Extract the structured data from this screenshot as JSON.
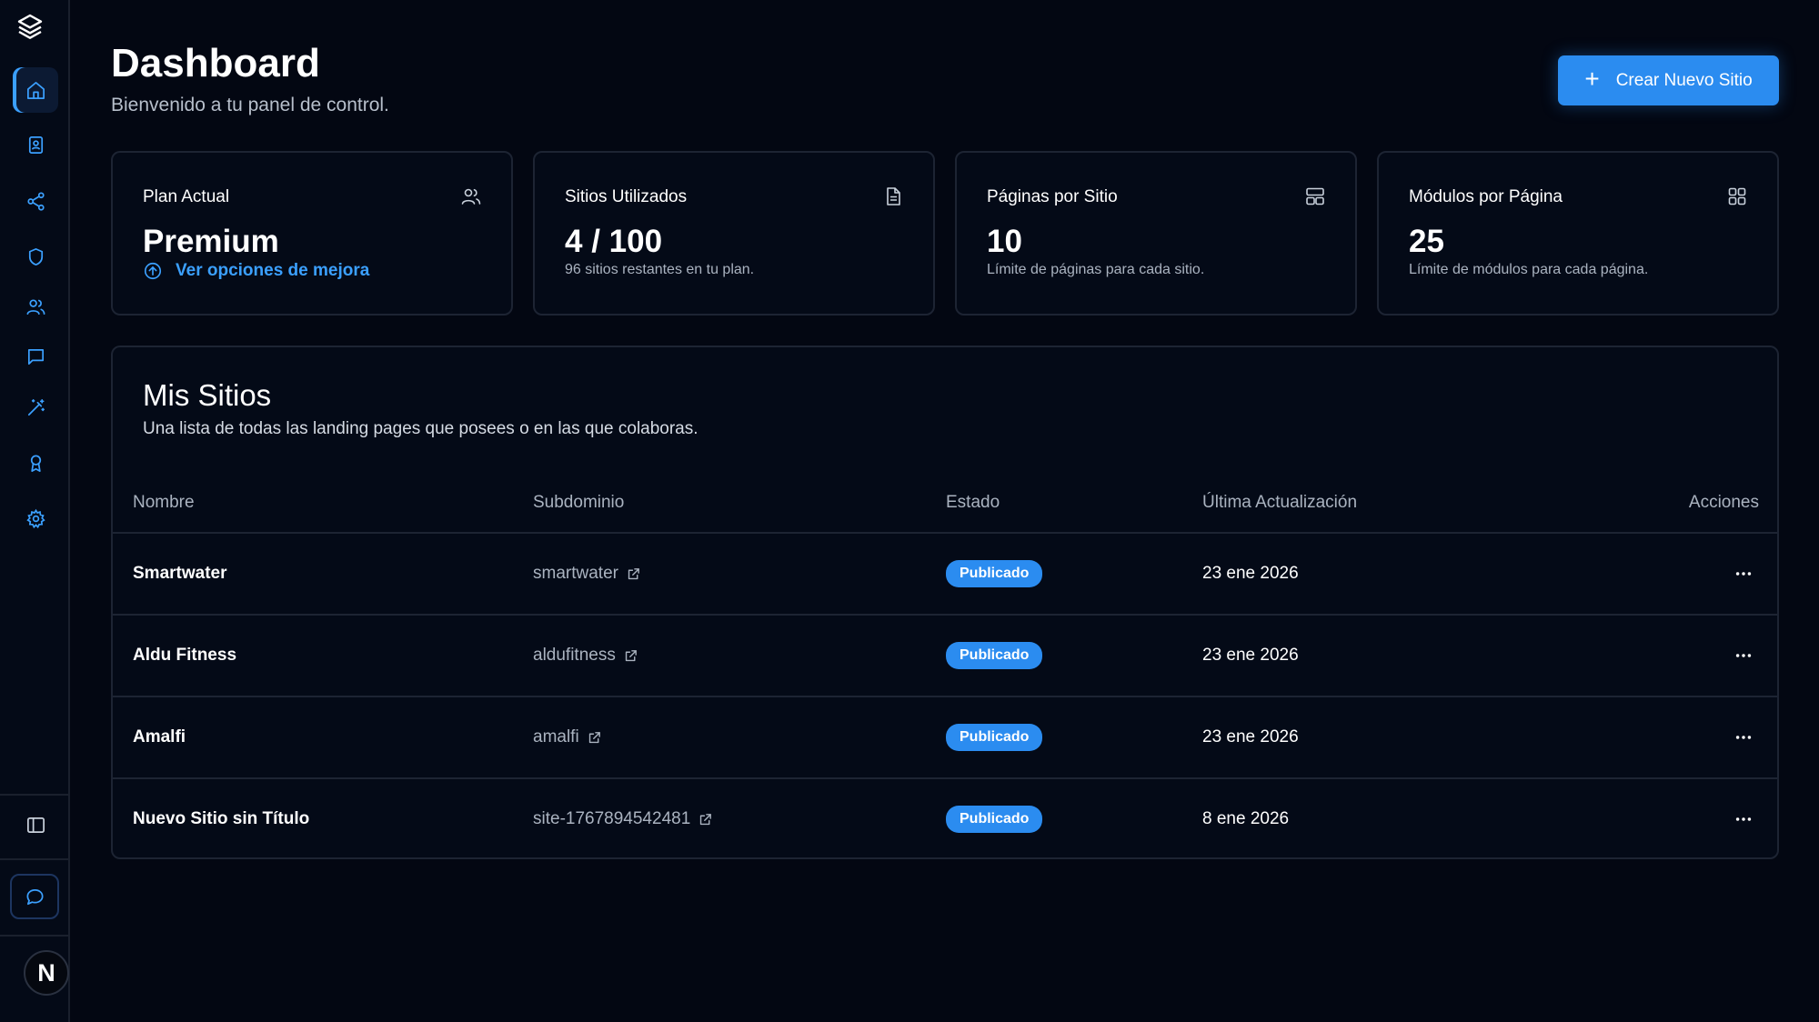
{
  "header": {
    "title": "Dashboard",
    "subtitle": "Bienvenido a tu panel de control.",
    "create_button_label": "Crear Nuevo Sitio"
  },
  "stats": [
    {
      "title": "Plan Actual",
      "value": "Premium",
      "link": "Ver opciones de mejora",
      "icon": "users-icon"
    },
    {
      "title": "Sitios Utilizados",
      "value": "4 / 100",
      "note": "96 sitios restantes en tu plan.",
      "icon": "document-icon"
    },
    {
      "title": "Páginas por Sitio",
      "value": "10",
      "note": "Límite de páginas para cada sitio.",
      "icon": "layout-icon"
    },
    {
      "title": "Módulos por Página",
      "value": "25",
      "note": "Límite de módulos para cada página.",
      "icon": "grid-icon"
    }
  ],
  "sites": {
    "title": "Mis Sitios",
    "description": "Una lista de todas las landing pages que posees o en las que colaboras.",
    "columns": [
      "Nombre",
      "Subdominio",
      "Estado",
      "Última Actualización",
      "Acciones"
    ],
    "rows": [
      {
        "name": "Smartwater",
        "subdomain": "smartwater",
        "status": "Publicado",
        "updated": "23 ene 2026"
      },
      {
        "name": "Aldu Fitness",
        "subdomain": "aldufitness",
        "status": "Publicado",
        "updated": "23 ene 2026"
      },
      {
        "name": "Amalfi",
        "subdomain": "amalfi",
        "status": "Publicado",
        "updated": "23 ene 2026"
      },
      {
        "name": "Nuevo Sitio sin Título",
        "subdomain": "site-1767894542481",
        "status": "Publicado",
        "updated": "8 ene 2026"
      }
    ]
  },
  "user": {
    "avatar_initial": "N"
  },
  "colors": {
    "background": "#030712",
    "accent": "#2b8cf0",
    "link": "#3ba0ff",
    "border": "#1d2433"
  }
}
